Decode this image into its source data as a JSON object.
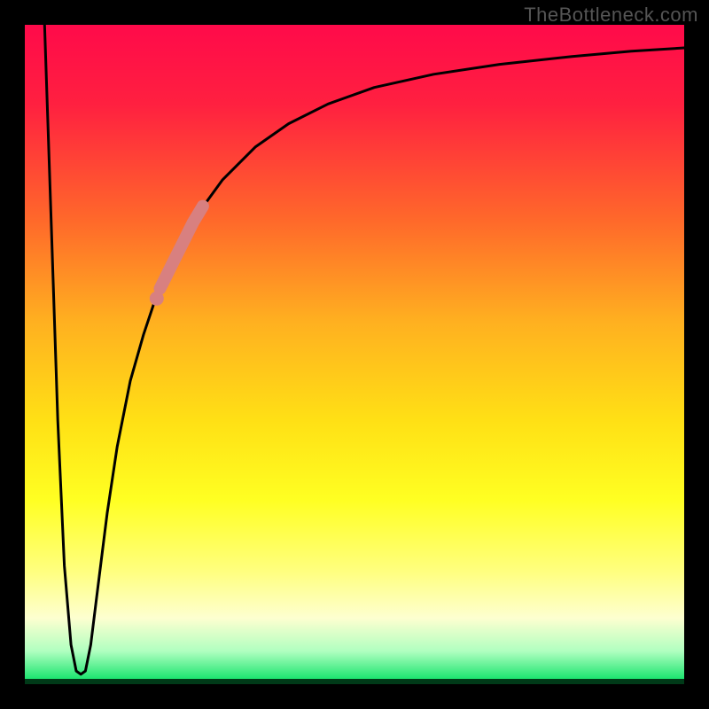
{
  "watermark": "TheBottleneck.com",
  "chart_data": {
    "type": "line",
    "title": "",
    "xlabel": "",
    "ylabel": "",
    "xlim": [
      0,
      100
    ],
    "ylim": [
      0,
      100
    ],
    "background_gradient": {
      "stops": [
        {
          "offset": 0.0,
          "color": "#ff0a4a"
        },
        {
          "offset": 0.12,
          "color": "#ff2040"
        },
        {
          "offset": 0.3,
          "color": "#ff6a2a"
        },
        {
          "offset": 0.45,
          "color": "#ffb020"
        },
        {
          "offset": 0.6,
          "color": "#ffe015"
        },
        {
          "offset": 0.72,
          "color": "#ffff22"
        },
        {
          "offset": 0.83,
          "color": "#ffff80"
        },
        {
          "offset": 0.9,
          "color": "#fdffd0"
        },
        {
          "offset": 0.95,
          "color": "#b0ffc0"
        },
        {
          "offset": 1.0,
          "color": "#00e060"
        }
      ]
    },
    "series": [
      {
        "name": "bottleneck-curve",
        "color": "#000000",
        "points": [
          {
            "x": 3.0,
            "y": 100.0
          },
          {
            "x": 4.0,
            "y": 70.0
          },
          {
            "x": 5.0,
            "y": 40.0
          },
          {
            "x": 6.0,
            "y": 18.0
          },
          {
            "x": 7.0,
            "y": 6.0
          },
          {
            "x": 7.8,
            "y": 2.0
          },
          {
            "x": 8.5,
            "y": 1.5
          },
          {
            "x": 9.2,
            "y": 2.0
          },
          {
            "x": 10.0,
            "y": 6.0
          },
          {
            "x": 11.0,
            "y": 14.0
          },
          {
            "x": 12.5,
            "y": 26.0
          },
          {
            "x": 14.0,
            "y": 36.0
          },
          {
            "x": 16.0,
            "y": 46.0
          },
          {
            "x": 18.0,
            "y": 53.0
          },
          {
            "x": 20.0,
            "y": 59.0
          },
          {
            "x": 23.0,
            "y": 65.5
          },
          {
            "x": 26.0,
            "y": 71.0
          },
          {
            "x": 30.0,
            "y": 76.5
          },
          {
            "x": 35.0,
            "y": 81.5
          },
          {
            "x": 40.0,
            "y": 85.0
          },
          {
            "x": 46.0,
            "y": 88.0
          },
          {
            "x": 53.0,
            "y": 90.5
          },
          {
            "x": 62.0,
            "y": 92.5
          },
          {
            "x": 72.0,
            "y": 94.0
          },
          {
            "x": 83.0,
            "y": 95.2
          },
          {
            "x": 92.0,
            "y": 96.0
          },
          {
            "x": 100.0,
            "y": 96.5
          }
        ]
      }
    ],
    "highlight_segment": {
      "name": "highlighted-range",
      "color": "#d88080",
      "points": [
        {
          "x": 20.5,
          "y": 60.0
        },
        {
          "x": 21.5,
          "y": 62.0
        },
        {
          "x": 22.5,
          "y": 64.0
        },
        {
          "x": 24.0,
          "y": 67.0
        },
        {
          "x": 25.5,
          "y": 70.0
        },
        {
          "x": 27.0,
          "y": 72.5
        }
      ]
    },
    "highlight_dot": {
      "x": 20.0,
      "y": 58.5,
      "color": "#d88080"
    }
  }
}
